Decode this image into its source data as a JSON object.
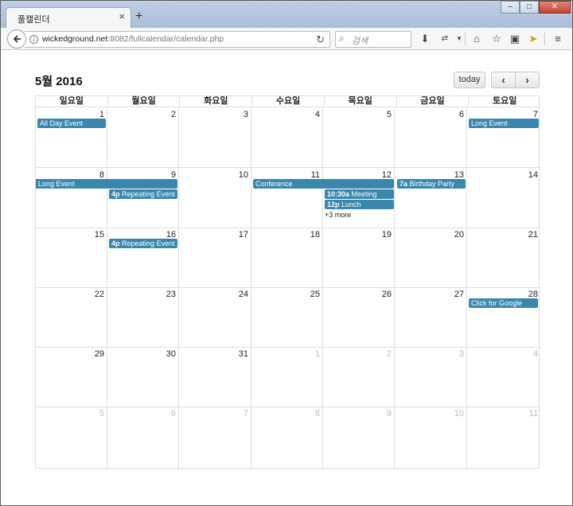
{
  "browser": {
    "tab_title": "풀캘린더",
    "tab_close": "×",
    "new_tab": "+",
    "url_domain": "wickedground.net",
    "url_rest": ":8082/fullcalendar/calendar.php",
    "search_placeholder": "검색"
  },
  "calendar": {
    "title": "5월 2016",
    "today_label": "today",
    "prev_label": "‹",
    "next_label": "›",
    "weekdays": [
      "일요일",
      "월요일",
      "화요일",
      "수요일",
      "목요일",
      "금요일",
      "토요일"
    ],
    "weeks": [
      [
        {
          "n": "1"
        },
        {
          "n": "2"
        },
        {
          "n": "3"
        },
        {
          "n": "4"
        },
        {
          "n": "5"
        },
        {
          "n": "6"
        },
        {
          "n": "7"
        }
      ],
      [
        {
          "n": "8"
        },
        {
          "n": "9"
        },
        {
          "n": "10"
        },
        {
          "n": "11"
        },
        {
          "n": "12"
        },
        {
          "n": "13"
        },
        {
          "n": "14"
        }
      ],
      [
        {
          "n": "15"
        },
        {
          "n": "16"
        },
        {
          "n": "17"
        },
        {
          "n": "18"
        },
        {
          "n": "19"
        },
        {
          "n": "20"
        },
        {
          "n": "21"
        }
      ],
      [
        {
          "n": "22"
        },
        {
          "n": "23"
        },
        {
          "n": "24"
        },
        {
          "n": "25"
        },
        {
          "n": "26"
        },
        {
          "n": "27"
        },
        {
          "n": "28"
        }
      ],
      [
        {
          "n": "29"
        },
        {
          "n": "30"
        },
        {
          "n": "31"
        },
        {
          "n": "1",
          "other": true
        },
        {
          "n": "2",
          "other": true
        },
        {
          "n": "3",
          "other": true
        },
        {
          "n": "4",
          "other": true
        }
      ],
      [
        {
          "n": "5",
          "other": true
        },
        {
          "n": "6",
          "other": true
        },
        {
          "n": "7",
          "other": true
        },
        {
          "n": "8",
          "other": true
        },
        {
          "n": "9",
          "other": true
        },
        {
          "n": "10",
          "other": true
        },
        {
          "n": "11",
          "other": true
        }
      ]
    ],
    "events": [
      {
        "title": "All Day Event",
        "time": ""
      },
      {
        "title": "Long Event",
        "time": ""
      },
      {
        "title": "Long Event",
        "time": ""
      },
      {
        "title": "Repeating Event",
        "time": "4p"
      },
      {
        "title": "Conference",
        "time": ""
      },
      {
        "title": "Meeting",
        "time": "10:30a"
      },
      {
        "title": "Lunch",
        "time": "12p"
      },
      {
        "title": "Birthday Party",
        "time": "7a"
      },
      {
        "title": "Repeating Event",
        "time": "4p"
      },
      {
        "title": "Click for Google",
        "time": ""
      }
    ],
    "more_label": "+3 more",
    "event_color": "#3a87ad"
  }
}
